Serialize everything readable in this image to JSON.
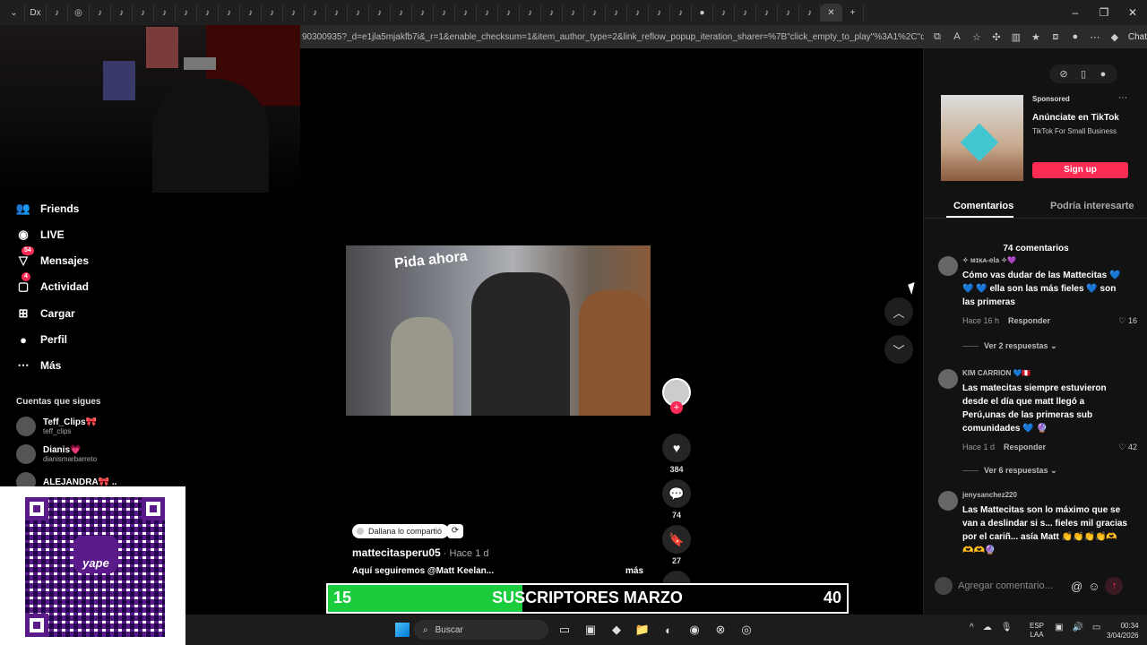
{
  "browser": {
    "url": "90300935?_d=e1jla5mjakfb7i&_r=1&enable_checksum=1&item_author_type=2&link_reflow_popup_iteration_sharer=%7B\"click_empty_to_play\"%3A1%2C\"dynamic_cover\"%3A1...",
    "chat_label": "Chat",
    "tab_icons": [
      "Dx",
      "tiktok",
      "instagram",
      "tiktok",
      "tiktok",
      "tiktok",
      "tiktok",
      "tiktok",
      "tiktok",
      "tiktok"
    ]
  },
  "sidebar": {
    "items": [
      {
        "label": "Friends",
        "icon": "friends-icon"
      },
      {
        "label": "LIVE",
        "icon": "live-icon"
      },
      {
        "label": "Mensajes",
        "icon": "messages-icon",
        "badge": "54"
      },
      {
        "label": "Actividad",
        "icon": "activity-icon",
        "badge": "4"
      },
      {
        "label": "Cargar",
        "icon": "upload-icon"
      },
      {
        "label": "Perfil",
        "icon": "profile-icon"
      },
      {
        "label": "Más",
        "icon": "more-icon"
      }
    ],
    "following_title": "Cuentas que sigues",
    "following": [
      {
        "name": "Teff_Clips🎀",
        "handle": "teff_clips"
      },
      {
        "name": "Dianis💗",
        "handle": "dianismarbarreto"
      },
      {
        "name": "ALEJANDRA🎀 ..",
        "handle": ""
      }
    ]
  },
  "qr": {
    "brand": "yape"
  },
  "video": {
    "shared_by": "Dallana lo compartió",
    "author": "mattecitasperu05",
    "time": " · Hace 1 d",
    "caption": "Aquí seguiremos @Matt Keelan...",
    "more": "más",
    "likes": "384",
    "comments": "74",
    "saves": "27",
    "sign_text": "Pida ahora"
  },
  "ad": {
    "sponsored": "Sponsored",
    "title": "Anúnciate en TikTok",
    "subtitle": "TikTok For Small Business",
    "cta": "Sign up"
  },
  "panel": {
    "tab_comments": "Comentarios",
    "tab_suggested": "Podría interesarte",
    "comment_count": "74 comentarios",
    "comments": [
      {
        "user": "✧ ᴍɪᴋᴀ-ela ✧💜",
        "text": "Cómo vas dudar de las Mattecitas 💙 💙 💙 ella son las más fieles 💙 son las primeras",
        "time": "Hace 16 h",
        "reply": "Responder",
        "likes": "16",
        "replies": "Ver 2 respuestas"
      },
      {
        "user": "KIM CARRION 💙🇵🇪",
        "text": "Las matecitas siempre estuvieron desde el día que matt llegó a Perú,unas de las primeras sub comunidades 💙 🔮",
        "time": "Hace 1 d",
        "reply": "Responder",
        "likes": "42",
        "replies": "Ver 6 respuestas"
      },
      {
        "user": "jenysanchez220",
        "text": "Las Mattecitas son lo máximo que se van a deslindar si s... fieles mil gracias por el cariñ... asía Matt 👏👏👏👏🫶🫶🫶🔮",
        "time": "",
        "reply": "",
        "likes": "",
        "replies": ""
      }
    ],
    "add_placeholder": "Agregar comentario..."
  },
  "banner": {
    "left": "15",
    "center": "SUSCRIPTORES MARZO",
    "right": "40",
    "progress": 0.375
  },
  "taskbar": {
    "search": "Buscar",
    "lang": "ESP",
    "lang2": "LAA",
    "time": "00:34",
    "date": "3/04/2026"
  },
  "colors": {
    "accent": "#fe2c55",
    "banner_fill": "#1bcc3c"
  }
}
